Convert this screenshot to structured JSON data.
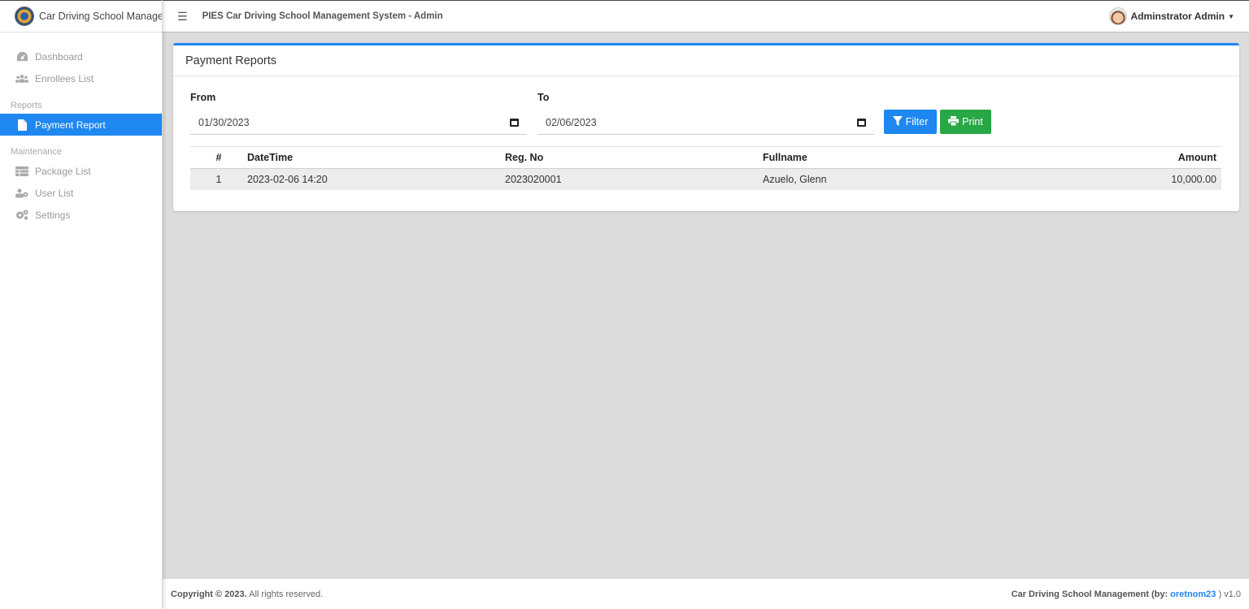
{
  "brand": {
    "name": "Car Driving School Management"
  },
  "topbar": {
    "title": "PIES Car Driving School Management System - Admin",
    "user": "Adminstrator Admin"
  },
  "sidebar": {
    "items": [
      {
        "label": "Dashboard",
        "icon": "dashboard-icon"
      },
      {
        "label": "Enrollees List",
        "icon": "users-icon"
      }
    ],
    "reports_header": "Reports",
    "reports_items": [
      {
        "label": "Payment Report",
        "icon": "file-icon"
      }
    ],
    "maintenance_header": "Maintenance",
    "maintenance_items": [
      {
        "label": "Package List",
        "icon": "table-icon"
      },
      {
        "label": "User List",
        "icon": "user-cog-icon"
      },
      {
        "label": "Settings",
        "icon": "cogs-icon"
      }
    ]
  },
  "card": {
    "title": "Payment Reports",
    "from_label": "From",
    "to_label": "To",
    "from_value": "01/30/2023",
    "to_value": "02/06/2023",
    "filter_label": "Filter",
    "print_label": "Print"
  },
  "table": {
    "headers": [
      "#",
      "DateTime",
      "Reg. No",
      "Fullname",
      "Amount"
    ],
    "rows": [
      {
        "num": "1",
        "datetime": "2023-02-06 14:20",
        "reg": "2023020001",
        "name": "Azuelo, Glenn",
        "amount": "10,000.00"
      }
    ]
  },
  "footer": {
    "copyright": "Copyright © 2023.",
    "rights": " All rights reserved.",
    "app": "Car Driving School Management (by: ",
    "author": "oretnom23",
    "version": " ) v1.0"
  },
  "colors": {
    "primary": "#1e87f0",
    "success": "#28a745"
  }
}
